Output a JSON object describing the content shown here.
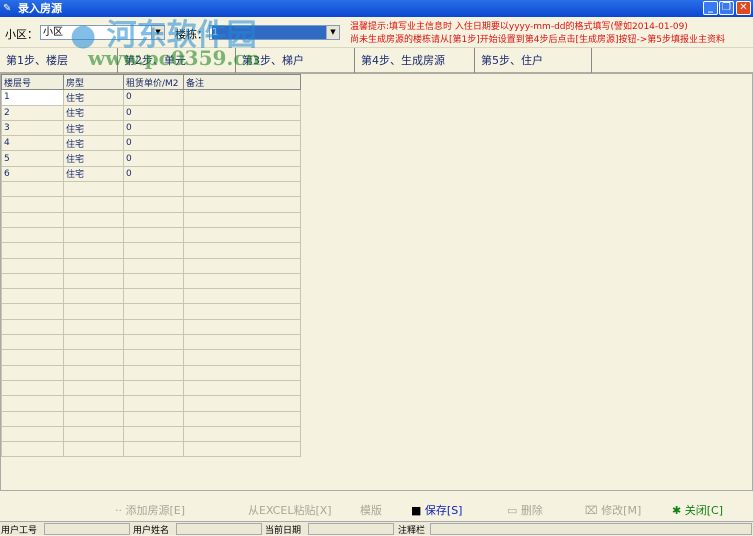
{
  "window": {
    "title": "录入房源",
    "minimize": "_",
    "restore": "❐",
    "close": "✕"
  },
  "filters": {
    "community_label": "小区：",
    "community_value": "小区",
    "building_label": "楼栋：",
    "building_value": "1"
  },
  "tips": [
    "温馨提示:填写业主信息时 入住日期要以yyyy-mm-dd的格式填写(譬如2014-01-09)",
    "尚未生成房源的楼栋请从[第1步]开始设置到第4步后点击[生成房源]按钮->第5步填报业主资料"
  ],
  "tabs": [
    "第1步、楼层",
    "第2步、单元",
    "第3步、梯户",
    "第4步、生成房源",
    "第5步、住户"
  ],
  "grid": {
    "columns": [
      "楼层号",
      "房型",
      "租赁单价/M2",
      "备注"
    ],
    "rows": [
      [
        "1",
        "住宅",
        "0",
        ""
      ],
      [
        "2",
        "住宅",
        "0",
        ""
      ],
      [
        "3",
        "住宅",
        "0",
        ""
      ],
      [
        "4",
        "住宅",
        "0",
        ""
      ],
      [
        "5",
        "住宅",
        "0",
        ""
      ],
      [
        "6",
        "住宅",
        "0",
        ""
      ]
    ]
  },
  "toolbar": {
    "add": "添加房源[E]",
    "paste": "从EXCEL粘贴[X]",
    "template": "模版",
    "save": "保存[S]",
    "delete": "删除",
    "edit": "修改[M]",
    "close": "关闭[C]"
  },
  "status": {
    "user_id": "用户工号",
    "user_name": "用户姓名",
    "date": "当前日期",
    "note": "注释栏"
  },
  "watermark": {
    "name": "河东软件园",
    "url": "www.pc0359.cn"
  }
}
